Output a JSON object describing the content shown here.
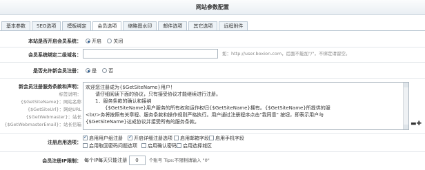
{
  "page": {
    "title": "网站参数配置"
  },
  "tabs": [
    {
      "label": "基本参数",
      "active": false
    },
    {
      "label": "SEO选项",
      "active": false
    },
    {
      "label": "模板绑定",
      "active": false
    },
    {
      "label": "会员选项",
      "active": true
    },
    {
      "label": "缩略图水印",
      "active": false
    },
    {
      "label": "邮件选项",
      "active": false
    },
    {
      "label": "其它选项",
      "active": false
    },
    {
      "label": "远程附件",
      "active": false
    }
  ],
  "member_open": {
    "label": "本站是否开启会员系统：",
    "opt_on": "开启",
    "opt_off": "关闭",
    "selected": "on"
  },
  "subdomain": {
    "label": "会员系统绑定二级域名：",
    "value": "",
    "hint": "如：http://user.boxion.com，后面不能加\"/\"，不绑定请留空。"
  },
  "allow_reg": {
    "label": "是否允许新会员注册：",
    "opt_yes": "是",
    "opt_no": "否",
    "selected": "yes"
  },
  "agreement": {
    "label": "新会员注册服务条款和声明：",
    "vars_title": "标签说明：",
    "vars": [
      "{$GetSiteName}：网站名称",
      "{$GetSiteUrl}：网站URL",
      "{$GetWebmaster}：站长",
      "{$GetWebmasterEmail}：站长信箱"
    ],
    "lines": [
      "欢迎您注册成为{$GetSiteName}用户！",
      "　　请仔细阅读下面的协议，只有接受协议才能继续进行注册。",
      "　　1．服务条款的确认和接纳",
      "　　　　{$GetSiteName}用户服务的所有权和运作权归{$GetSiteName}拥有。{$GetSiteName}所提供的服",
      "<br/>务将按照有关章程、服务条款和操作规则严格执行。用户通过注册程序点击\"我同意\" 按钮，即表示用户与",
      "{$GetSiteName}达成协议并接受所有的服务条款。"
    ]
  },
  "reg_options": {
    "label": "注册启用选项：",
    "items": [
      {
        "label": "启用用户组注册",
        "checked": true
      },
      {
        "label": "开启详细注册选项",
        "checked": true
      },
      {
        "label": "启用邮箱字段",
        "checked": false
      },
      {
        "label": "启用手机字段",
        "checked": false
      },
      {
        "label": "启用取回密码问题选项",
        "checked": false
      },
      {
        "label": "启用确认密码",
        "checked": false
      },
      {
        "label": "启用选择城区",
        "checked": false
      }
    ]
  },
  "ip_limit": {
    "label": "会员注册IP限制：",
    "prefix": "每个IP每天只能注册",
    "value": "0",
    "suffix": "个账号 Tips:不限制请输入 \"0\""
  }
}
